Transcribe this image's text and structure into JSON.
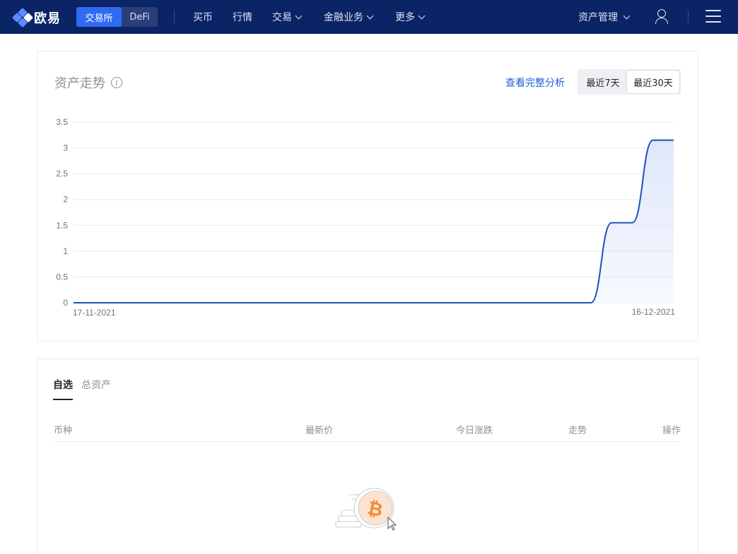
{
  "nav": {
    "logo_text": "欧易",
    "segment": [
      "交易所",
      "DeFi"
    ],
    "items": [
      "买币",
      "行情",
      "交易",
      "金融业务",
      "更多"
    ],
    "asset_menu": "资产管理"
  },
  "asset_card": {
    "title": "资产走势",
    "analysis_link": "查看完整分析",
    "range_buttons": [
      "最近7天",
      "最近30天"
    ],
    "selected_range": "最近30天"
  },
  "chart_data": {
    "type": "area",
    "title": "",
    "xlabel": "",
    "ylabel": "",
    "x_tick_labels": [
      "17-11-2021",
      "16-12-2021"
    ],
    "y_ticks": [
      "0",
      "0.5",
      "1",
      "1.5",
      "2",
      "2.5",
      "3",
      "3.5"
    ],
    "ylim": [
      0,
      3.5
    ],
    "x": [
      "17-11-2021",
      "18-11-2021",
      "19-11-2021",
      "20-11-2021",
      "21-11-2021",
      "22-11-2021",
      "23-11-2021",
      "24-11-2021",
      "25-11-2021",
      "26-11-2021",
      "27-11-2021",
      "28-11-2021",
      "29-11-2021",
      "30-11-2021",
      "01-12-2021",
      "02-12-2021",
      "03-12-2021",
      "04-12-2021",
      "05-12-2021",
      "06-12-2021",
      "07-12-2021",
      "08-12-2021",
      "09-12-2021",
      "10-12-2021",
      "11-12-2021",
      "12-12-2021",
      "13-12-2021",
      "14-12-2021",
      "15-12-2021",
      "16-12-2021"
    ],
    "series": [
      {
        "values": [
          0,
          0,
          0,
          0,
          0,
          0,
          0,
          0,
          0,
          0,
          0,
          0,
          0,
          0,
          0,
          0,
          0,
          0,
          0,
          0,
          0,
          0,
          0,
          0,
          0,
          0,
          1.55,
          1.55,
          3.15,
          3.15
        ]
      }
    ],
    "grid": true,
    "line_color": "#1d4fc4",
    "fill_color": "#dfe7fb"
  },
  "watchlist": {
    "tabs": [
      "自选",
      "总资产"
    ],
    "columns": [
      "币种",
      "最新价",
      "今日涨跌",
      "走势",
      "操作"
    ]
  },
  "colors": {
    "nav_bg": "#0b2466",
    "accent": "#2f6bf2",
    "link": "#2161d6"
  }
}
